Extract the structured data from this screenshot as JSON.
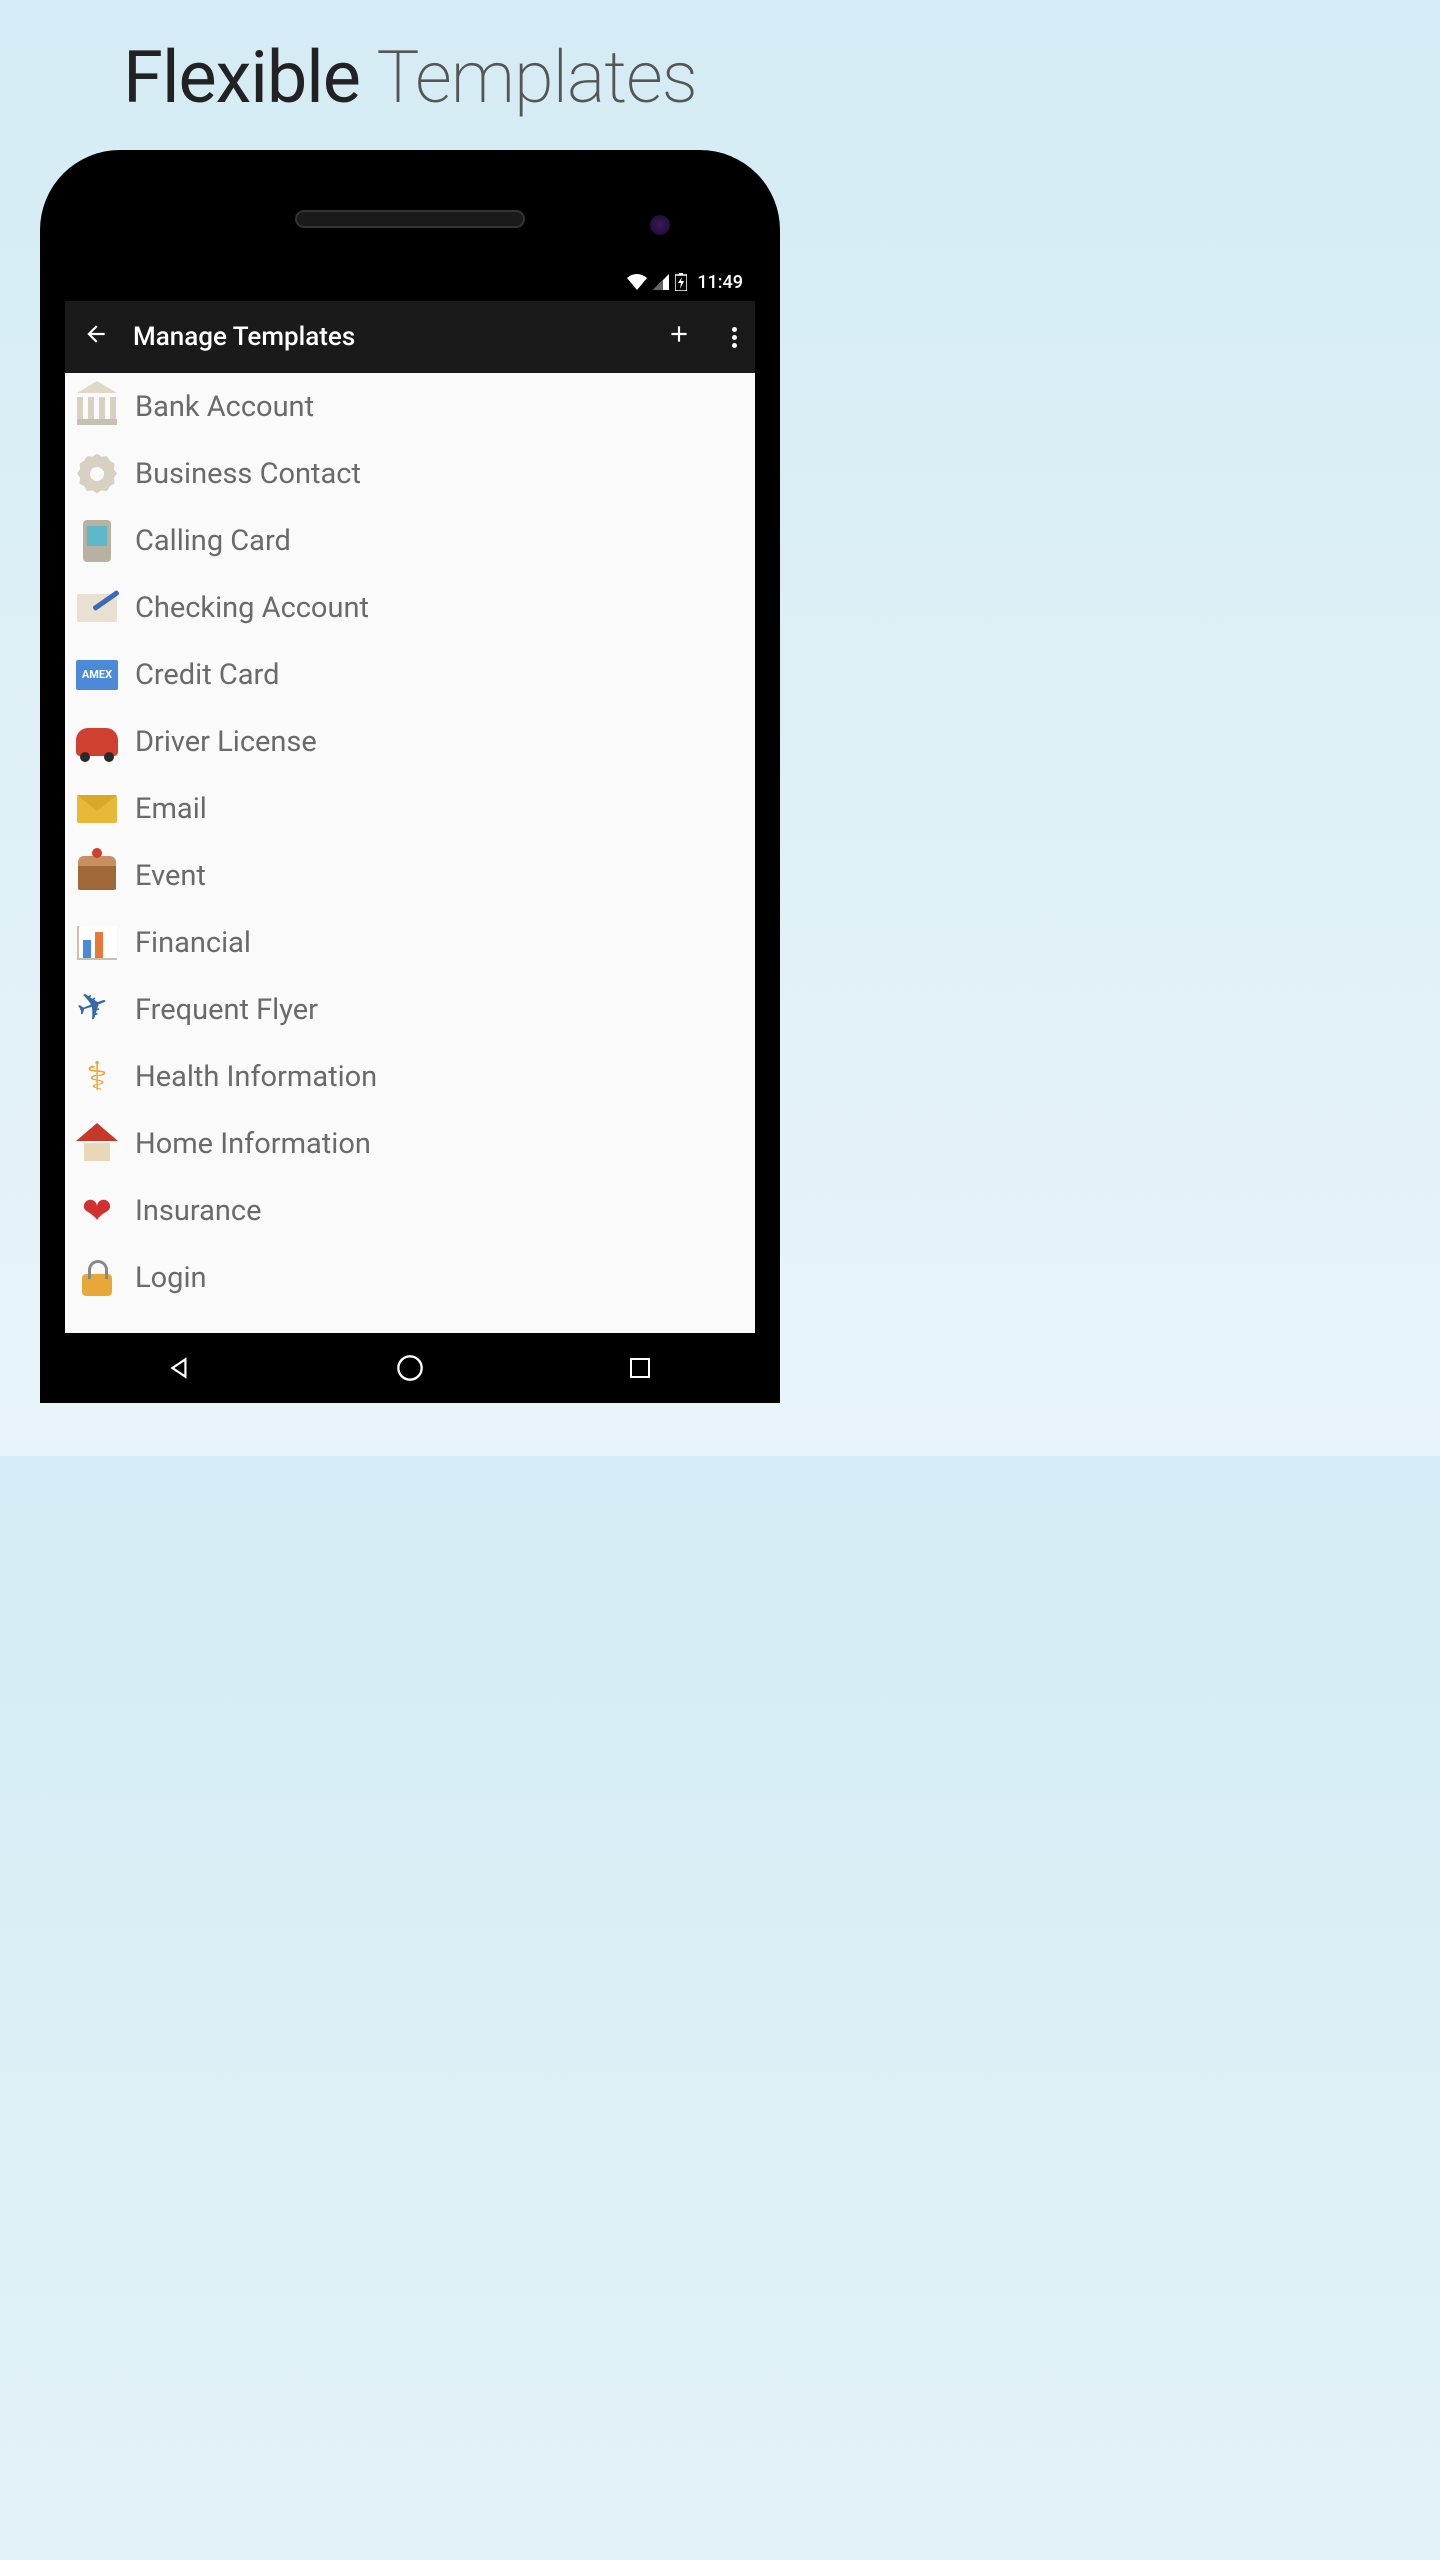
{
  "marketing": {
    "title_bold": "Flexible",
    "title_light": "Templates"
  },
  "status_bar": {
    "time": "11:49"
  },
  "app_bar": {
    "title": "Manage Templates"
  },
  "templates": [
    {
      "icon": "bank-icon",
      "label": "Bank Account"
    },
    {
      "icon": "gear-icon",
      "label": "Business Contact"
    },
    {
      "icon": "phone-icon",
      "label": "Calling Card"
    },
    {
      "icon": "check-icon",
      "label": "Checking Account"
    },
    {
      "icon": "amex-icon",
      "label": "Credit Card"
    },
    {
      "icon": "car-icon",
      "label": "Driver License"
    },
    {
      "icon": "mail-icon",
      "label": "Email"
    },
    {
      "icon": "cake-icon",
      "label": "Event"
    },
    {
      "icon": "chart-icon",
      "label": "Financial"
    },
    {
      "icon": "plane-icon",
      "label": "Frequent Flyer"
    },
    {
      "icon": "health-icon",
      "label": "Health Information"
    },
    {
      "icon": "home-icon",
      "label": "Home Information"
    },
    {
      "icon": "heart-icon",
      "label": "Insurance"
    },
    {
      "icon": "lock-icon",
      "label": "Login"
    }
  ]
}
